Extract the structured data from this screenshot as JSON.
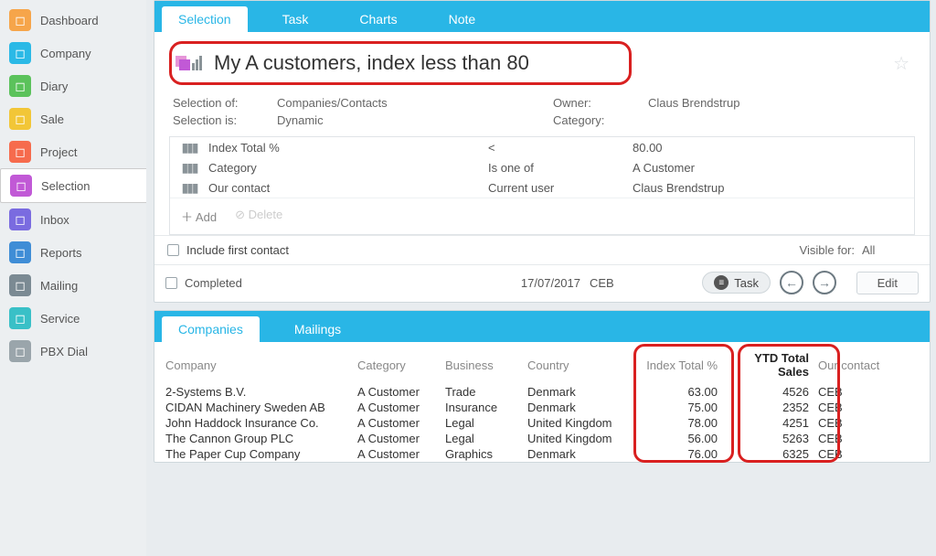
{
  "sidebar": {
    "items": [
      {
        "label": "Dashboard",
        "color": "#f6a54a"
      },
      {
        "label": "Company",
        "color": "#2bb9e6"
      },
      {
        "label": "Diary",
        "color": "#5bc25b"
      },
      {
        "label": "Sale",
        "color": "#f2c637"
      },
      {
        "label": "Project",
        "color": "#f66b4d"
      },
      {
        "label": "Selection",
        "color": "#c159d6"
      },
      {
        "label": "Inbox",
        "color": "#7a6be0"
      },
      {
        "label": "Reports",
        "color": "#3f8dd6"
      },
      {
        "label": "Mailing",
        "color": "#7b8a93"
      },
      {
        "label": "Service",
        "color": "#39c0c7"
      },
      {
        "label": "PBX Dial",
        "color": "#9aa5ab"
      }
    ],
    "active_index": 5
  },
  "top_tabs": [
    "Selection",
    "Task",
    "Charts",
    "Note"
  ],
  "top_active": 0,
  "selection": {
    "title": "My A customers, index less than 80",
    "meta": {
      "selection_of_label": "Selection of:",
      "selection_of": "Companies/Contacts",
      "selection_is_label": "Selection is:",
      "selection_is": "Dynamic",
      "owner_label": "Owner:",
      "owner": "Claus Brendstrup",
      "category_label": "Category:",
      "category": ""
    },
    "criteria": [
      {
        "field": "Index Total %",
        "op": "<",
        "value": "80.00"
      },
      {
        "field": "Category",
        "op": "Is one of",
        "value": "A Customer"
      },
      {
        "field": "Our contact",
        "op": "Current user",
        "value": "Claus Brendstrup"
      }
    ],
    "add_label": "Add",
    "delete_label": "Delete",
    "include_first_label": "Include first contact",
    "visible_for_label": "Visible for:",
    "visible_for_value": "All",
    "completed_label": "Completed",
    "date": "17/07/2017",
    "user_code": "CEB",
    "task_btn": "Task",
    "edit_btn": "Edit"
  },
  "bottom_tabs": [
    "Companies",
    "Mailings"
  ],
  "bottom_active": 0,
  "table": {
    "headers": {
      "company": "Company",
      "category": "Category",
      "business": "Business",
      "country": "Country",
      "index": "Index Total %",
      "ytd": "YTD Total Sales",
      "contact": "Our contact"
    },
    "rows": [
      {
        "company": "2-Systems B.V.",
        "category": "A Customer",
        "business": "Trade",
        "country": "Denmark",
        "index": "63.00",
        "ytd": "4526",
        "contact": "CEB"
      },
      {
        "company": "CIDAN Machinery Sweden AB",
        "category": "A Customer",
        "business": "Insurance",
        "country": "Denmark",
        "index": "75.00",
        "ytd": "2352",
        "contact": "CEB"
      },
      {
        "company": "John Haddock Insurance Co.",
        "category": "A Customer",
        "business": "Legal",
        "country": "United Kingdom",
        "index": "78.00",
        "ytd": "4251",
        "contact": "CEB"
      },
      {
        "company": "The Cannon Group PLC",
        "category": "A Customer",
        "business": "Legal",
        "country": "United Kingdom",
        "index": "56.00",
        "ytd": "5263",
        "contact": "CEB"
      },
      {
        "company": "The Paper Cup Company",
        "category": "A Customer",
        "business": "Graphics",
        "country": "Denmark",
        "index": "76.00",
        "ytd": "6325",
        "contact": "CEB"
      }
    ]
  }
}
